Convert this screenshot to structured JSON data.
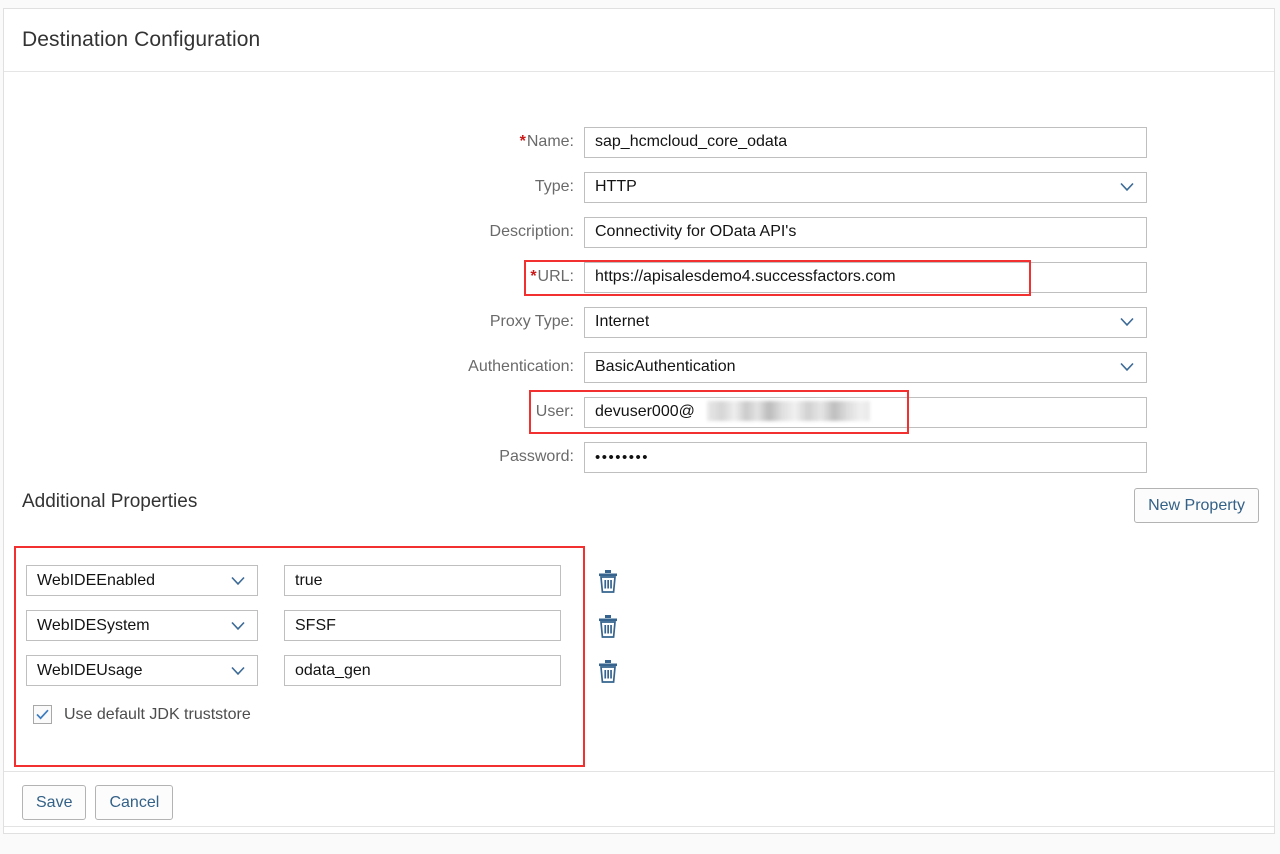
{
  "header": {
    "title": "Destination Configuration"
  },
  "form": {
    "fields": [
      {
        "label": "Name:",
        "required": true,
        "value": "sap_hcmcloud_core_odata",
        "control": "input",
        "name": "name"
      },
      {
        "label": "Type:",
        "required": false,
        "value": "HTTP",
        "control": "dropdown",
        "name": "type"
      },
      {
        "label": "Description:",
        "required": false,
        "value": "Connectivity for OData API's",
        "control": "input",
        "name": "description"
      },
      {
        "label": "URL:",
        "required": true,
        "value": "https://apisalesdemo4.successfactors.com",
        "control": "input",
        "name": "url"
      },
      {
        "label": "Proxy Type:",
        "required": false,
        "value": "Internet",
        "control": "dropdown",
        "name": "proxy-type"
      },
      {
        "label": "Authentication:",
        "required": false,
        "value": "BasicAuthentication",
        "control": "dropdown",
        "name": "authentication"
      },
      {
        "label": "User:",
        "required": false,
        "value": "devuser000@",
        "control": "input",
        "name": "user",
        "redacted": true
      },
      {
        "label": "Password:",
        "required": false,
        "value": "••••••••",
        "control": "password",
        "name": "password"
      }
    ]
  },
  "additional_properties": {
    "section_title": "Additional Properties",
    "new_property_label": "New Property",
    "rows": [
      {
        "key": "WebIDEEnabled",
        "value": "true",
        "delete_icon": "trash-icon"
      },
      {
        "key": "WebIDESystem",
        "value": "SFSF",
        "delete_icon": "trash-icon"
      },
      {
        "key": "WebIDEUsage",
        "value": "odata_gen",
        "delete_icon": "trash-icon"
      }
    ],
    "truststore": {
      "label": "Use default JDK truststore",
      "checked": true
    }
  },
  "footer": {
    "save_label": "Save",
    "cancel_label": "Cancel"
  },
  "annotations": [
    {
      "name": "url-highlight",
      "color": "#f23030"
    },
    {
      "name": "user-highlight",
      "color": "#f23030"
    },
    {
      "name": "properties-highlight",
      "color": "#f23030"
    }
  ],
  "colors": {
    "accent_link": "#346187",
    "label_gray": "#6a6a6a",
    "required_red": "#cc1919",
    "annotation_red": "#f23030",
    "border_gray": "#bfbfbf"
  },
  "icons": {
    "chevron_down": "chevron-down-icon",
    "trash": "trash-icon",
    "checkmark": "check-icon"
  }
}
